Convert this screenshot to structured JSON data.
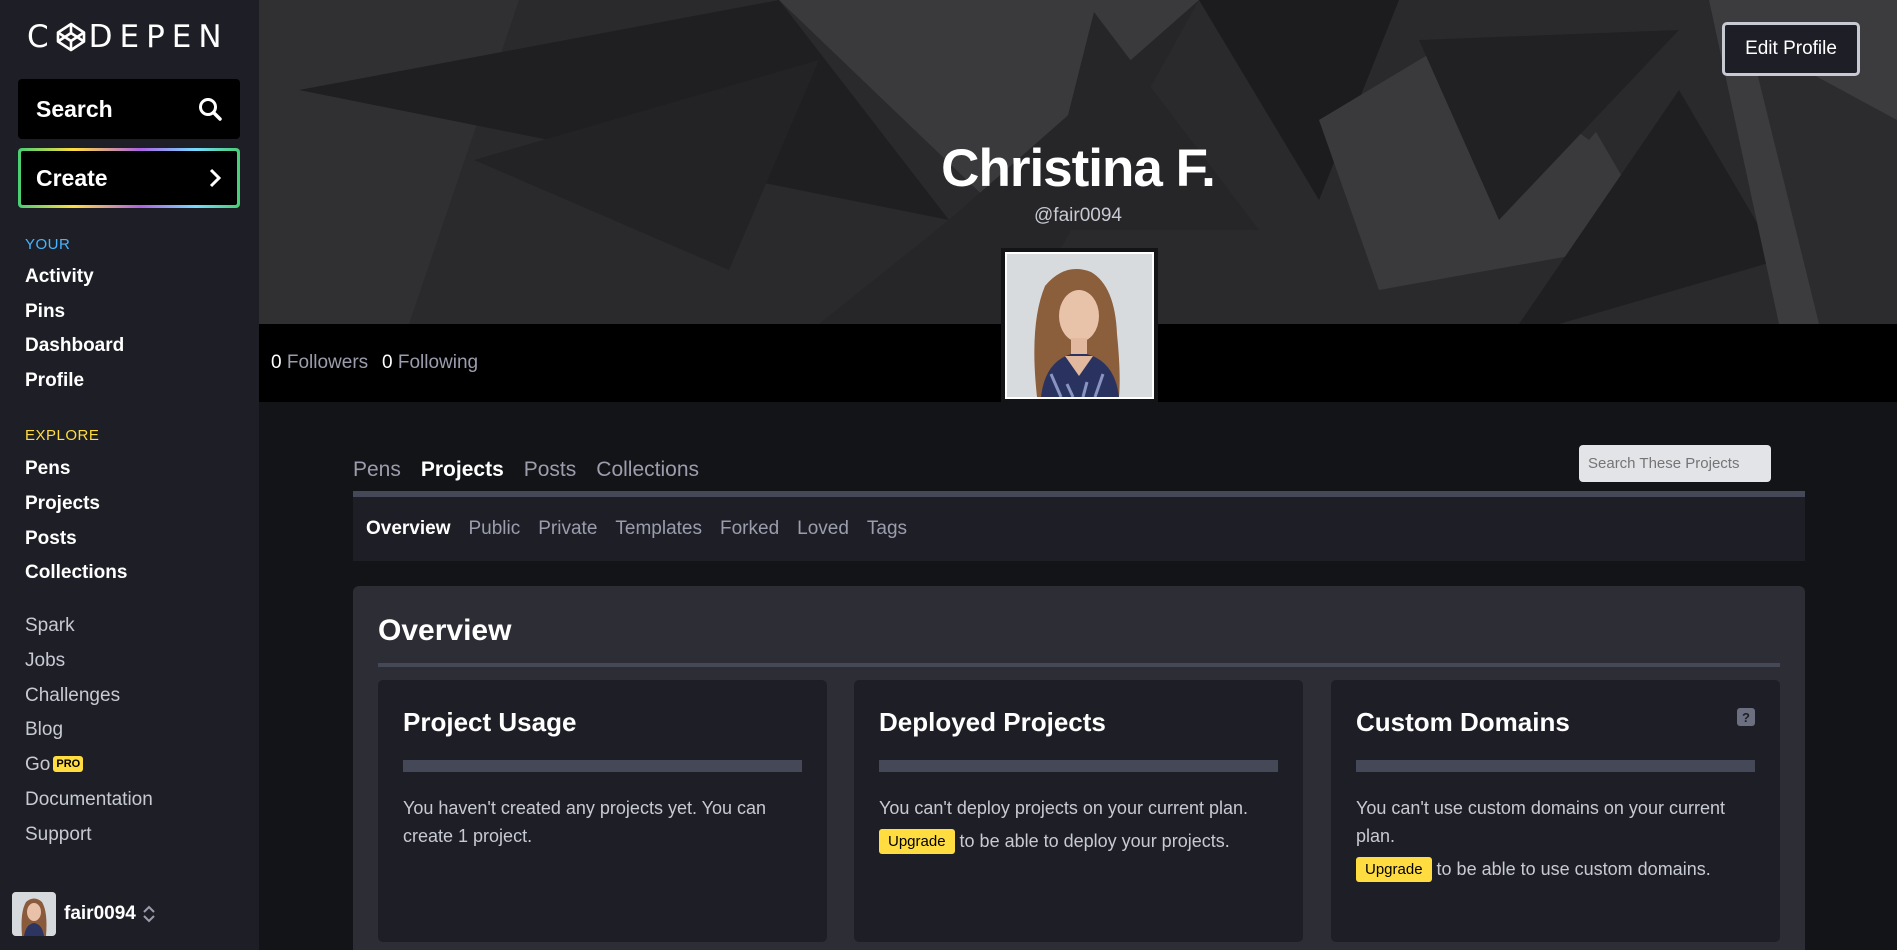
{
  "brand": {
    "logo_text_left": "C",
    "logo_text_right": "DEPEN"
  },
  "sidebar": {
    "search_label": "Search",
    "create_label": "Create",
    "your_heading": "YOUR",
    "your_items": [
      "Activity",
      "Pins",
      "Dashboard",
      "Profile"
    ],
    "explore_heading": "EXPLORE",
    "explore_items": [
      "Pens",
      "Projects",
      "Posts",
      "Collections"
    ],
    "misc_items": [
      "Spark",
      "Jobs",
      "Challenges",
      "Blog",
      "Go",
      "Documentation",
      "Support"
    ],
    "pro_badge": "PRO",
    "username": "fair0094"
  },
  "profile": {
    "name": "Christina F.",
    "handle": "@fair0094",
    "edit_label": "Edit Profile",
    "followers_count": "0",
    "followers_label": "Followers",
    "following_count": "0",
    "following_label": "Following"
  },
  "tabs": {
    "main": [
      "Pens",
      "Projects",
      "Posts",
      "Collections"
    ],
    "active_main": "Projects",
    "search_placeholder": "Search These Projects",
    "sub": [
      "Overview",
      "Public",
      "Private",
      "Templates",
      "Forked",
      "Loved",
      "Tags"
    ],
    "active_sub": "Overview"
  },
  "overview": {
    "title": "Overview",
    "cards": [
      {
        "title": "Project Usage",
        "text": "You haven't created any projects yet. You can create 1 project."
      },
      {
        "title": "Deployed Projects",
        "text": "You can't deploy projects on your current plan.",
        "upgrade_label": "Upgrade",
        "upgrade_text": "to be able to deploy your projects."
      },
      {
        "title": "Custom Domains",
        "text": "You can't use custom domains on your current plan.",
        "upgrade_label": "Upgrade",
        "upgrade_text": "to be able to use custom domains.",
        "help": "?"
      }
    ]
  },
  "colors": {
    "your_heading": "#47b4ff",
    "explore_heading": "#ffdd40",
    "upgrade": "#ffdd40"
  }
}
